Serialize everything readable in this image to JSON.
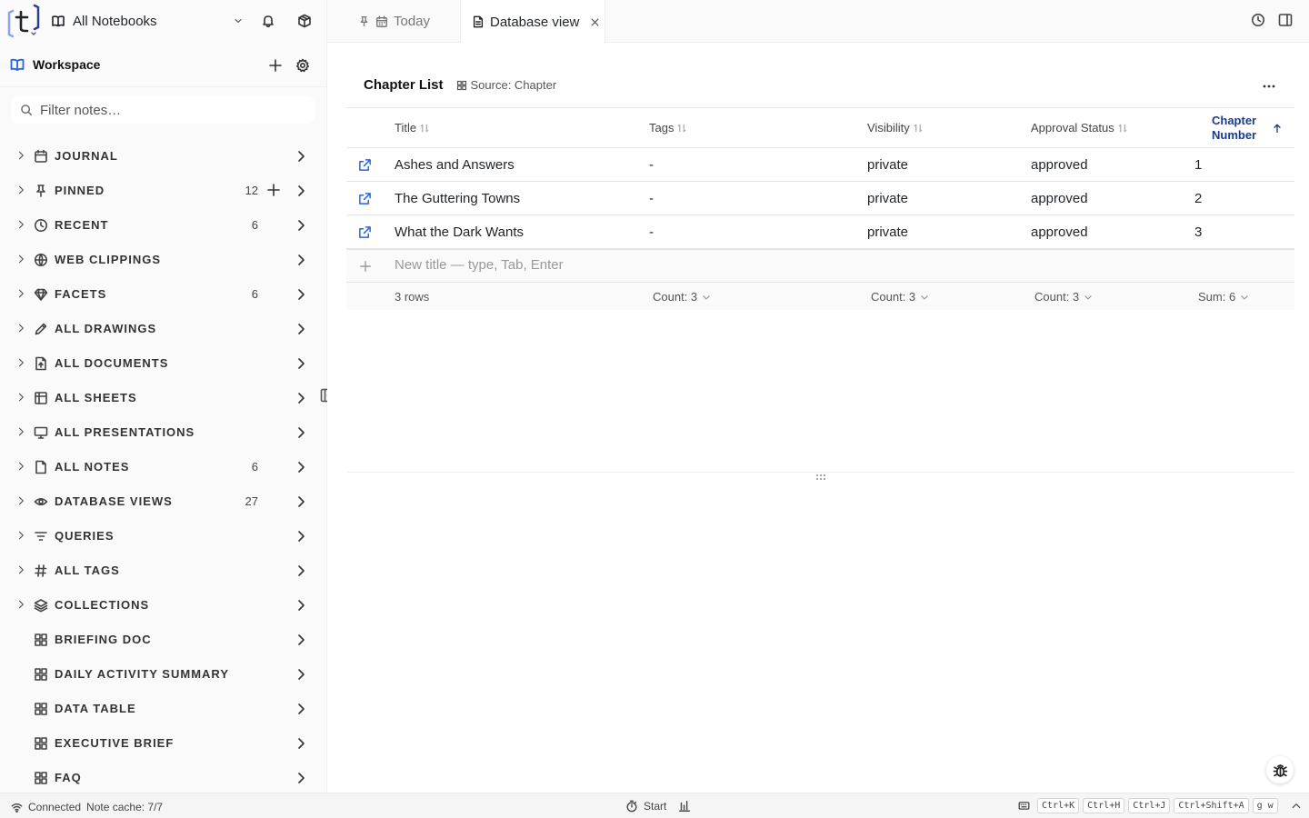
{
  "sidebar": {
    "notebook_select": "All Notebooks",
    "workspace_title": "Workspace",
    "filter_placeholder": "Filter notes…",
    "items": [
      {
        "label": "JOURNAL",
        "icon": "calendar-icon",
        "count": "",
        "plus": false,
        "expand": true
      },
      {
        "label": "PINNED",
        "icon": "pin-icon",
        "count": "12",
        "plus": true,
        "expand": true
      },
      {
        "label": "RECENT",
        "icon": "clock-icon",
        "count": "6",
        "plus": false,
        "expand": true
      },
      {
        "label": "WEB CLIPPINGS",
        "icon": "globe-icon",
        "count": "",
        "plus": false,
        "expand": true
      },
      {
        "label": "FACETS",
        "icon": "diamond-icon",
        "count": "6",
        "plus": false,
        "expand": true
      },
      {
        "label": "ALL DRAWINGS",
        "icon": "pencil-icon",
        "count": "",
        "plus": false,
        "expand": true
      },
      {
        "label": "ALL DOCUMENTS",
        "icon": "document-icon",
        "count": "",
        "plus": false,
        "expand": true
      },
      {
        "label": "ALL SHEETS",
        "icon": "sheet-icon",
        "count": "",
        "plus": false,
        "expand": true
      },
      {
        "label": "ALL PRESENTATIONS",
        "icon": "presentation-icon",
        "count": "",
        "plus": false,
        "expand": true
      },
      {
        "label": "ALL NOTES",
        "icon": "note-icon",
        "count": "6",
        "plus": false,
        "expand": true
      },
      {
        "label": "DATABASE VIEWS",
        "icon": "eye-icon",
        "count": "27",
        "plus": false,
        "expand": true
      },
      {
        "label": "QUERIES",
        "icon": "filter-icon",
        "count": "",
        "plus": false,
        "expand": true
      },
      {
        "label": "ALL TAGS",
        "icon": "hash-icon",
        "count": "",
        "plus": false,
        "expand": true
      },
      {
        "label": "COLLECTIONS",
        "icon": "layers-icon",
        "count": "",
        "plus": false,
        "expand": true
      },
      {
        "label": "BRIEFING DOC",
        "icon": "grid-icon",
        "count": "",
        "plus": false,
        "expand": false
      },
      {
        "label": "DAILY ACTIVITY SUMMARY",
        "icon": "grid-icon",
        "count": "",
        "plus": false,
        "expand": false
      },
      {
        "label": "DATA TABLE",
        "icon": "grid-icon",
        "count": "",
        "plus": false,
        "expand": false
      },
      {
        "label": "EXECUTIVE BRIEF",
        "icon": "grid-icon",
        "count": "",
        "plus": false,
        "expand": false
      },
      {
        "label": "FAQ",
        "icon": "grid-icon",
        "count": "",
        "plus": false,
        "expand": false
      }
    ]
  },
  "tabs": [
    {
      "label": "Today",
      "active": false
    },
    {
      "label": "Database view",
      "active": true
    }
  ],
  "view": {
    "title": "Chapter List",
    "source": "Source: Chapter",
    "columns": [
      "Title",
      "Tags",
      "Visibility",
      "Approval Status",
      "Chapter Number"
    ],
    "sorted_column_lines": [
      "Chapter",
      "Number"
    ],
    "rows": [
      {
        "title": "Ashes and Answers",
        "tags": "-",
        "visibility": "private",
        "approval": "approved",
        "number": "1"
      },
      {
        "title": "The Guttering Towns",
        "tags": "-",
        "visibility": "private",
        "approval": "approved",
        "number": "2"
      },
      {
        "title": "What the Dark Wants",
        "tags": "-",
        "visibility": "private",
        "approval": "approved",
        "number": "3"
      }
    ],
    "new_row_placeholder": "New title — type, Tab, Enter",
    "footer": {
      "rows": "3 rows",
      "tags": "Count: 3",
      "visibility": "Count: 3",
      "approval": "Count: 3",
      "number": "Sum: 6"
    }
  },
  "status": {
    "connection": "Connected",
    "cache": "Note cache: 7/7",
    "timer": "Start",
    "shortcuts": [
      "Ctrl+K",
      "Ctrl+H",
      "Ctrl+J",
      "Ctrl+Shift+A",
      "g w"
    ]
  },
  "colors": {
    "accent": "#2563eb",
    "sorted_header": "#1e3a8a"
  }
}
